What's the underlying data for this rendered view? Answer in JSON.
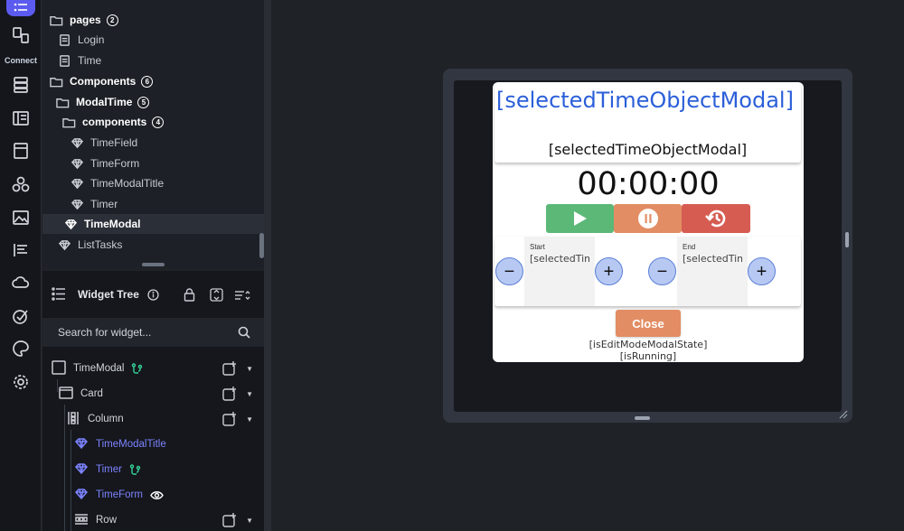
{
  "rail": {
    "connect_label": "Connect"
  },
  "pages_tree": {
    "pages_folder": {
      "label": "pages",
      "count": "2"
    },
    "pages": [
      {
        "label": "Login"
      },
      {
        "label": "Time"
      }
    ],
    "components_folder": {
      "label": "Components",
      "count": "6"
    },
    "modaltime_folder": {
      "label": "ModalTime",
      "count": "5"
    },
    "sub_components_folder": {
      "label": "components",
      "count": "4"
    },
    "sub_components": [
      {
        "label": "TimeField"
      },
      {
        "label": "TimeForm"
      },
      {
        "label": "TimeModalTitle"
      },
      {
        "label": "Timer"
      }
    ],
    "selected": {
      "label": "TimeModal"
    },
    "list_tasks": {
      "label": "ListTasks"
    }
  },
  "widget_tree": {
    "title": "Widget Tree",
    "search_placeholder": "Search for widget...",
    "rows": [
      {
        "label": "TimeModal"
      },
      {
        "label": "Card"
      },
      {
        "label": "Column"
      },
      {
        "label": "TimeModalTitle"
      },
      {
        "label": "Timer"
      },
      {
        "label": "TimeForm"
      },
      {
        "label": "Row"
      }
    ]
  },
  "modal": {
    "title_big": "[selectedTimeObjectModal]",
    "title_small": "[selectedTimeObjectModal]",
    "timer_value": "00:00:00",
    "buttons": {
      "play_color": "#5cb877",
      "pause_color": "#e28d63",
      "reset_color": "#d65c52"
    },
    "start_field": {
      "label": "Start",
      "value": "[selectedTimeObjectModal]"
    },
    "end_field": {
      "label": "End",
      "value": "[selectedTimeObjectModal]"
    },
    "minus_symbol": "−",
    "plus_symbol": "+",
    "close_label": "Close",
    "state_line_1": "[isEditModeModalState]",
    "state_line_2": "[isRunning]"
  },
  "colors": {
    "accent": "#5b5bf0",
    "component_text": "#7c83ff",
    "title_blue": "#2b5fd9"
  }
}
